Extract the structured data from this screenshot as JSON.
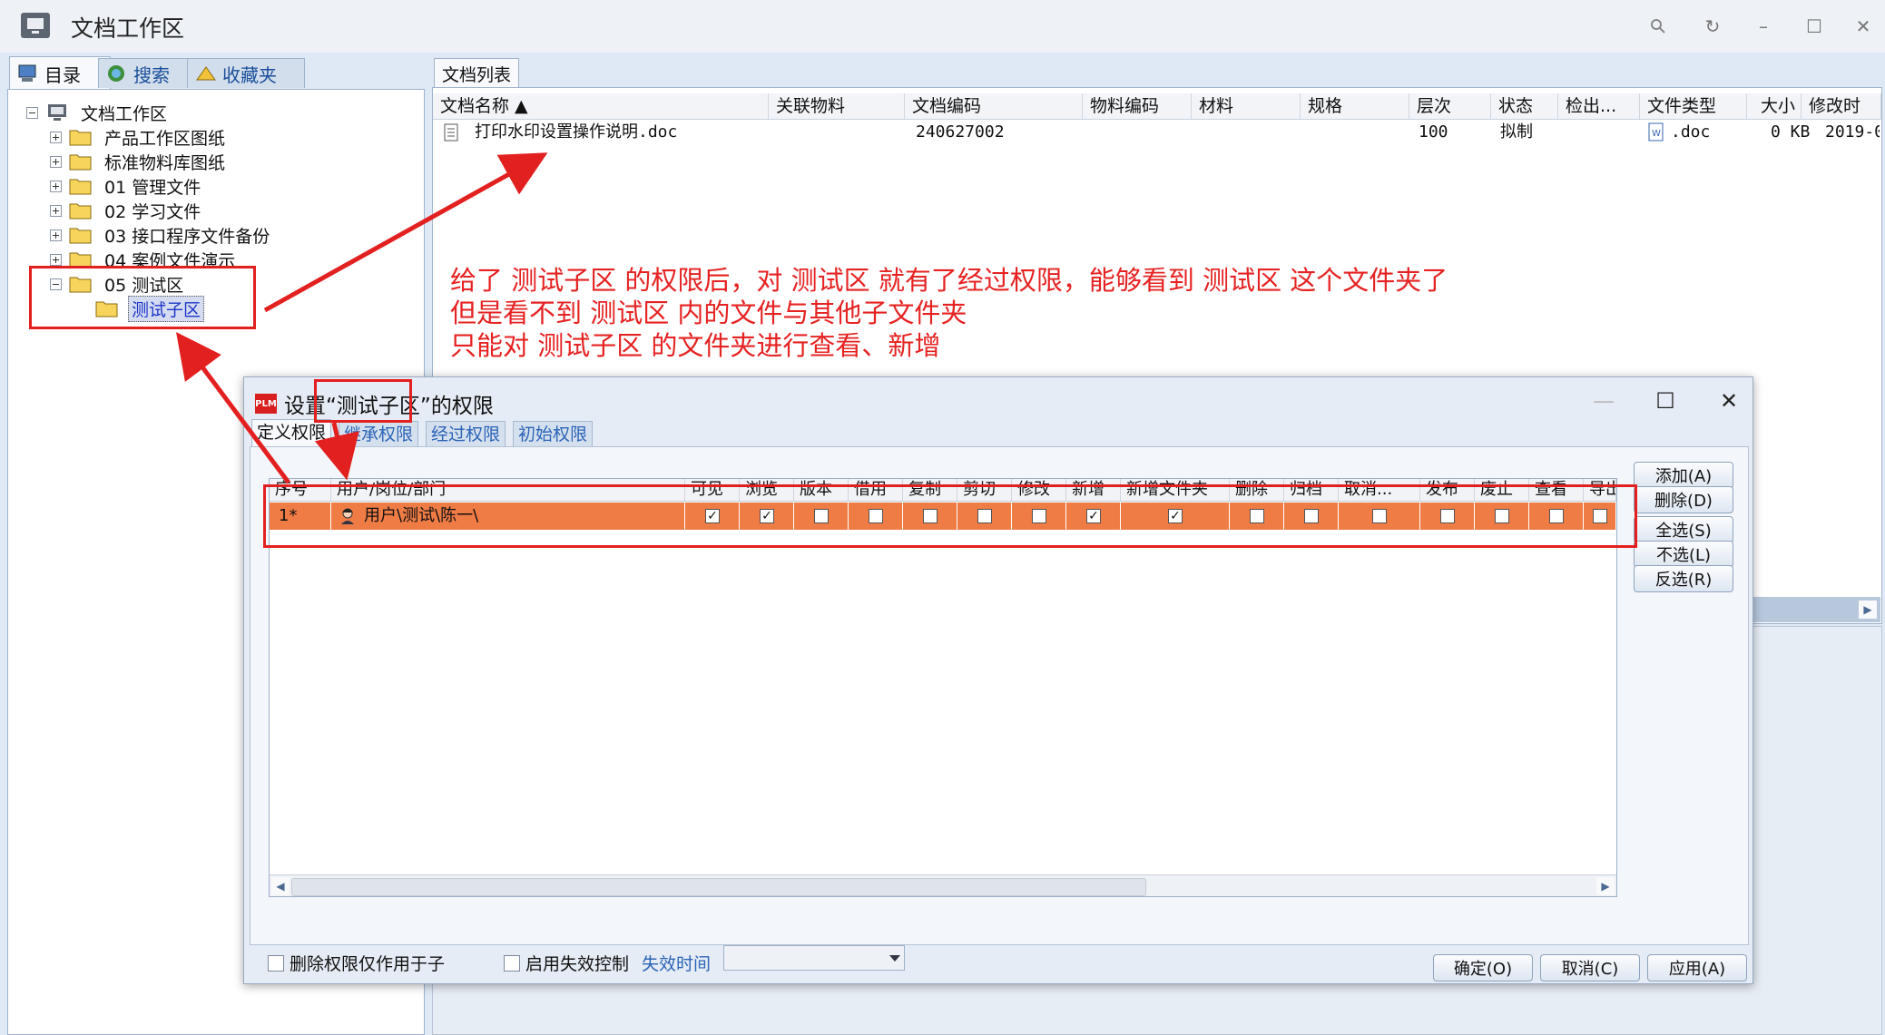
{
  "window": {
    "title": "文档工作区",
    "icon": "monitor-icon"
  },
  "left_tabs": [
    {
      "label": "目录",
      "icon": "directory-icon",
      "active": true
    },
    {
      "label": "搜索",
      "icon": "search-globe-icon",
      "active": false
    },
    {
      "label": "收藏夹",
      "icon": "favorites-icon",
      "active": false
    }
  ],
  "tree": {
    "root": "文档工作区",
    "items": [
      {
        "label": "产品工作区图纸",
        "expanded": false
      },
      {
        "label": "标准物料库图纸",
        "expanded": false
      },
      {
        "label": "01 管理文件",
        "expanded": false
      },
      {
        "label": "02 学习文件",
        "expanded": false
      },
      {
        "label": "03 接口程序文件备份",
        "expanded": false
      },
      {
        "label": "04 案例文件演示",
        "expanded": false
      },
      {
        "label": "05 测试区",
        "expanded": true
      },
      {
        "label": "测试子区",
        "selected": true
      }
    ]
  },
  "doc_list": {
    "tab": "文档列表",
    "columns": [
      "文档名称",
      "关联物料",
      "文档编码",
      "物料编码",
      "材料",
      "规格",
      "层次",
      "状态",
      "检出...",
      "文件类型",
      "大小",
      "修改时"
    ],
    "rows": [
      {
        "name": "打印水印设置操作说明.doc",
        "material": "",
        "code": "240627002",
        "material_code": "",
        "mat": "",
        "spec": "",
        "level": "100",
        "status": "拟制",
        "checkout": "",
        "type": ".doc",
        "size": "0 KB",
        "modified": "2019-0"
      }
    ]
  },
  "annotation": {
    "lines": [
      "给了 测试子区 的权限后，对 测试区 就有了经过权限，能够看到 测试区 这个文件夹了",
      "但是看不到 测试区 内的文件与其他子文件夹",
      "只能对 测试子区 的文件夹进行查看、新增"
    ],
    "color": "#e62222"
  },
  "dialog": {
    "logo": "PLM",
    "title": "设置“测试子区”的权限",
    "tabs": [
      "定义权限",
      "继承权限",
      "经过权限",
      "初始权限"
    ],
    "grid": {
      "columns": [
        "序号",
        "用户/岗位/部门",
        "可见",
        "浏览",
        "版本",
        "借用",
        "复制",
        "剪切",
        "修改",
        "新增",
        "新增文件夹",
        "删除",
        "归档",
        "取消...",
        "发布",
        "废止",
        "查看",
        "导出"
      ],
      "rows": [
        {
          "index": "1*",
          "principal": "用户\\测试\\陈一\\",
          "perms": [
            true,
            true,
            false,
            false,
            false,
            false,
            false,
            true,
            true,
            false,
            false,
            false,
            false,
            false,
            false,
            false
          ]
        }
      ]
    },
    "side_buttons": [
      "添加(A)",
      "删除(D)",
      "全选(S)",
      "不选(L)",
      "反选(R)"
    ],
    "options": {
      "delete_only_child": "删除权限仅作用于子",
      "enable_expire": "启用失效控制",
      "expire_time_label": "失效时间",
      "expire_time_value": ""
    },
    "footer_buttons": [
      "确定(O)",
      "取消(C)",
      "应用(A)"
    ]
  },
  "colors": {
    "row_highlight": "#ef7b45",
    "annotation_red": "#e32020"
  }
}
